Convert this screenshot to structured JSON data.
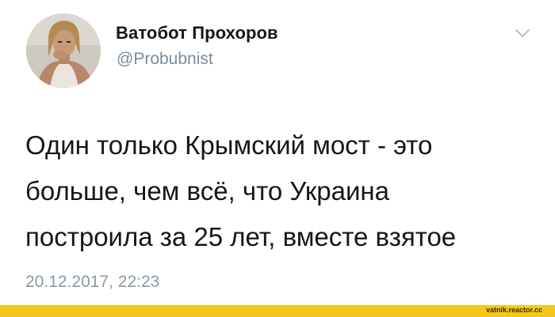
{
  "tweet": {
    "display_name": "Ватобот Прохоров",
    "handle": "@Probubnist",
    "text_lines": [
      "Один только Крымский мост - это",
      "больше, чем всё, что Украина",
      "построила за 25 лет, вместе взятое"
    ],
    "timestamp": "20.12.2017, 22:23"
  },
  "icons": {
    "avatar": "avatar-photo",
    "menu": "chevron-down-icon"
  },
  "colors": {
    "name": "#14171a",
    "secondary_text": "#7b8a96",
    "watermark_bar": "#f6c61c"
  },
  "watermark": {
    "text": "vatnik.reactor.cc"
  }
}
